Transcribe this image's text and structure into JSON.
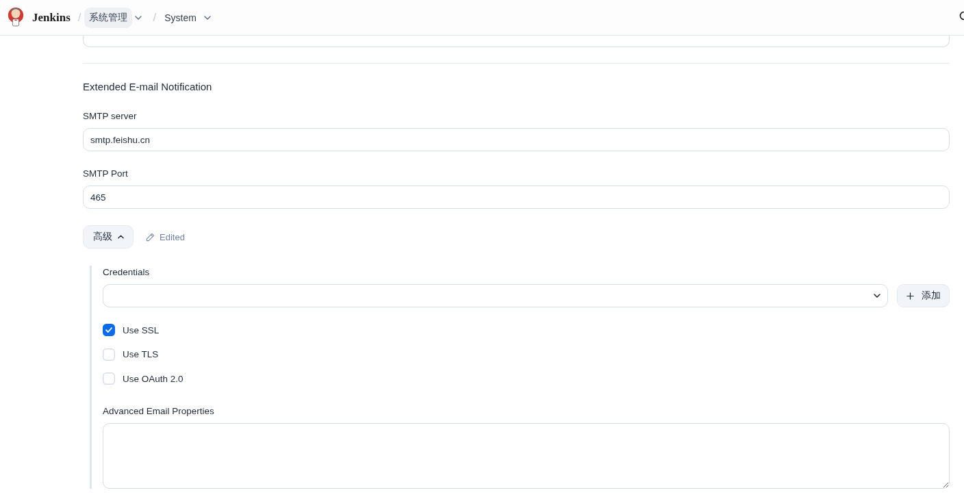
{
  "header": {
    "logo_text": "Jenkins",
    "breadcrumbs": [
      {
        "separator": "/",
        "label": "系统管理",
        "highlighted": true
      },
      {
        "separator": "/",
        "label": "System",
        "highlighted": false
      }
    ]
  },
  "section": {
    "title": "Extended E-mail Notification",
    "fields": [
      {
        "label": "SMTP server",
        "value": "smtp.feishu.cn"
      },
      {
        "label": "SMTP Port",
        "value": "465"
      }
    ],
    "advanced_button": {
      "label": "高级",
      "expanded": true
    },
    "edited_badge": "Edited",
    "advanced": {
      "credentials": {
        "label": "Credentials",
        "add_button": "添加"
      },
      "options": [
        {
          "label": "Use SSL",
          "checked": true
        },
        {
          "label": "Use TLS",
          "checked": false
        },
        {
          "label": "Use OAuth 2.0",
          "checked": false
        }
      ],
      "properties": {
        "label": "Advanced Email Properties"
      }
    }
  }
}
